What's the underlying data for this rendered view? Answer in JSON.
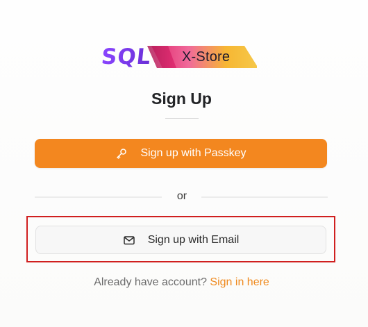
{
  "logo": {
    "part1": "SQL",
    "part2": "X-Store"
  },
  "title": "Sign Up",
  "buttons": {
    "passkey": {
      "label": "Sign up with Passkey",
      "icon": "key-icon"
    },
    "email": {
      "label": "Sign up with Email",
      "icon": "mail-icon"
    }
  },
  "divider": {
    "text": "or"
  },
  "footer": {
    "prompt": "Already have account?",
    "link_label": "Sign in here"
  },
  "colors": {
    "accent": "#f3871f",
    "link": "#ef8a1e",
    "highlight": "#d01f1f",
    "logo_purple": "#7b3fe4"
  }
}
